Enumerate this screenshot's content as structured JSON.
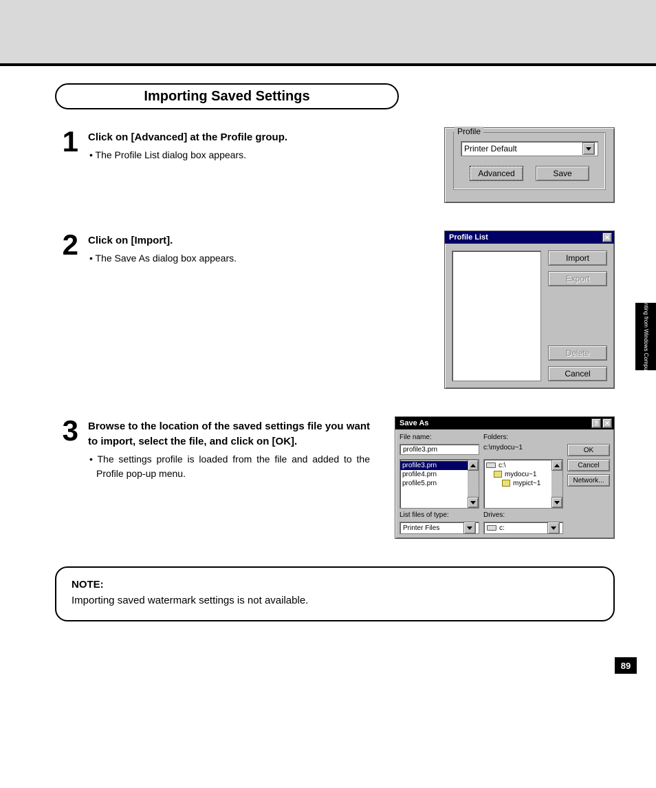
{
  "page": {
    "title": "Importing Saved Settings",
    "side_tab": "Printing from\nWindows Computer",
    "number": "89"
  },
  "steps": [
    {
      "num": "1",
      "head": "Click on [Advanced] at the Profile group.",
      "bullet": "The Profile List dialog box appears."
    },
    {
      "num": "2",
      "head": "Click on [Import].",
      "bullet": "The Save As dialog box appears."
    },
    {
      "num": "3",
      "head": "Browse to the location of the saved settings file you want to import, select the file, and click on [OK].",
      "bullet": "The settings profile is loaded from the file and added to the Profile pop-up menu."
    }
  ],
  "note": {
    "title": "NOTE:",
    "body": "Importing saved watermark settings is not available."
  },
  "dialog_profile": {
    "group_label": "Profile",
    "combo_value": "Printer Default",
    "buttons": {
      "advanced": "Advanced",
      "save": "Save"
    }
  },
  "dialog_profile_list": {
    "title": "Profile List",
    "buttons": {
      "import": "Import",
      "export": "Export",
      "delete": "Delete",
      "cancel": "Cancel"
    }
  },
  "dialog_save_as": {
    "title": "Save As",
    "labels": {
      "file_name": "File name:",
      "folders": "Folders:",
      "list_type": "List files of type:",
      "drives": "Drives:"
    },
    "file_name_value": "profile3.prn",
    "folder_path": "c:\\mydocu~1",
    "file_list": [
      "profile3.prn",
      "profile4.prn",
      "profile5.prn"
    ],
    "folder_tree": [
      "c:\\",
      "mydocu~1",
      "mypict~1"
    ],
    "list_type_value": "Printer Files",
    "drive_value": "c:",
    "buttons": {
      "ok": "OK",
      "cancel": "Cancel",
      "network": "Network..."
    }
  }
}
